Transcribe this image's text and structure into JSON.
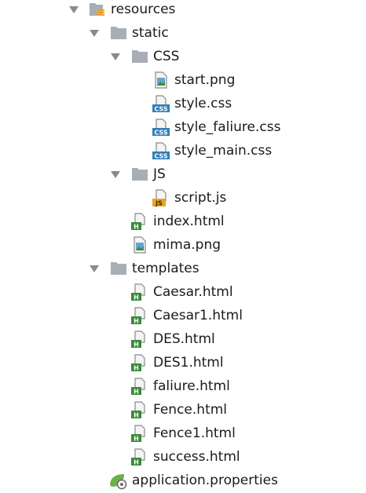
{
  "tree": {
    "resources": {
      "label": "resources"
    },
    "static": {
      "label": "static"
    },
    "css_folder": {
      "label": "CSS"
    },
    "css_files": [
      {
        "label": "start.png"
      },
      {
        "label": "style.css"
      },
      {
        "label": "style_faliure.css"
      },
      {
        "label": "style_main.css"
      }
    ],
    "js_folder": {
      "label": "JS"
    },
    "js_files": [
      {
        "label": "script.js"
      }
    ],
    "static_files": [
      {
        "label": "index.html"
      },
      {
        "label": "mima.png"
      }
    ],
    "templates": {
      "label": "templates"
    },
    "template_files": [
      {
        "label": "Caesar.html"
      },
      {
        "label": "Caesar1.html"
      },
      {
        "label": "DES.html"
      },
      {
        "label": "DES1.html"
      },
      {
        "label": "faliure.html"
      },
      {
        "label": "Fence.html"
      },
      {
        "label": "Fence1.html"
      },
      {
        "label": "success.html"
      }
    ],
    "app_props": {
      "label": "application.properties"
    }
  },
  "icons": {
    "folder": "folder-icon",
    "resources": "resources-folder-icon",
    "html": "html-file-icon",
    "css": "css-file-icon",
    "js": "js-file-icon",
    "image": "image-file-icon",
    "properties": "properties-file-icon"
  },
  "colors": {
    "folder": "#a8aeb5",
    "html_badge": "#3a8a3a",
    "css_badge": "#2f7fb8",
    "js_badge": "#e8a32a",
    "text": "#1a1a1a"
  }
}
